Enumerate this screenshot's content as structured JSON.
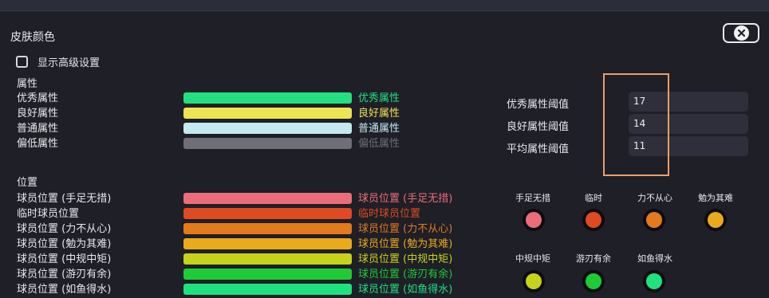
{
  "window": {
    "title": "皮肤颜色"
  },
  "advanced": {
    "label": "显示高级设置",
    "checked": false
  },
  "attributes": {
    "section": "属性",
    "items": [
      {
        "name": "优秀属性",
        "color": "#22e082",
        "preview": "优秀属性"
      },
      {
        "name": "良好属性",
        "color": "#ece453",
        "preview": "良好属性"
      },
      {
        "name": "普通属性",
        "color": "#c4e9ef",
        "preview": "普通属性"
      },
      {
        "name": "偏低属性",
        "color": "#6e6f77",
        "preview": "偏低属性"
      }
    ]
  },
  "positions": {
    "section": "位置",
    "items": [
      {
        "name": "球员位置 (手足无措)",
        "color": "#ec6d79",
        "preview": "球员位置 (手足无措)"
      },
      {
        "name": "临时球员位置",
        "color": "#e04a20",
        "preview": "临时球员位置"
      },
      {
        "name": "球员位置 (力不从心)",
        "color": "#e37a1b",
        "preview": "球员位置 (力不从心)"
      },
      {
        "name": "球员位置 (勉为其难)",
        "color": "#e9ab1c",
        "preview": "球员位置 (勉为其难)"
      },
      {
        "name": "球员位置 (中规中矩)",
        "color": "#c6d21c",
        "preview": "球员位置 (中规中矩)"
      },
      {
        "name": "球员位置 (游刃有余)",
        "color": "#1ecb36",
        "preview": "球员位置 (游刃有余)"
      },
      {
        "name": "球员位置 (如鱼得水)",
        "color": "#1fe27e",
        "preview": "球员位置 (如鱼得水)"
      }
    ]
  },
  "thresholds": [
    {
      "label": "优秀属性阈值",
      "value": "17"
    },
    {
      "label": "良好属性阈值",
      "value": "14"
    },
    {
      "label": "平均属性阈值",
      "value": "11"
    }
  ],
  "swatches": [
    {
      "label": "手足无措",
      "color": "#ec6d79"
    },
    {
      "label": "临时",
      "color": "#e04a20"
    },
    {
      "label": "力不从心",
      "color": "#e37a1b"
    },
    {
      "label": "勉为其难",
      "color": "#e9ab1c"
    },
    {
      "label": "中规中矩",
      "color": "#c6d21c"
    },
    {
      "label": "游刃有余",
      "color": "#1ecb36"
    },
    {
      "label": "如鱼得水",
      "color": "#1fe27e"
    }
  ]
}
